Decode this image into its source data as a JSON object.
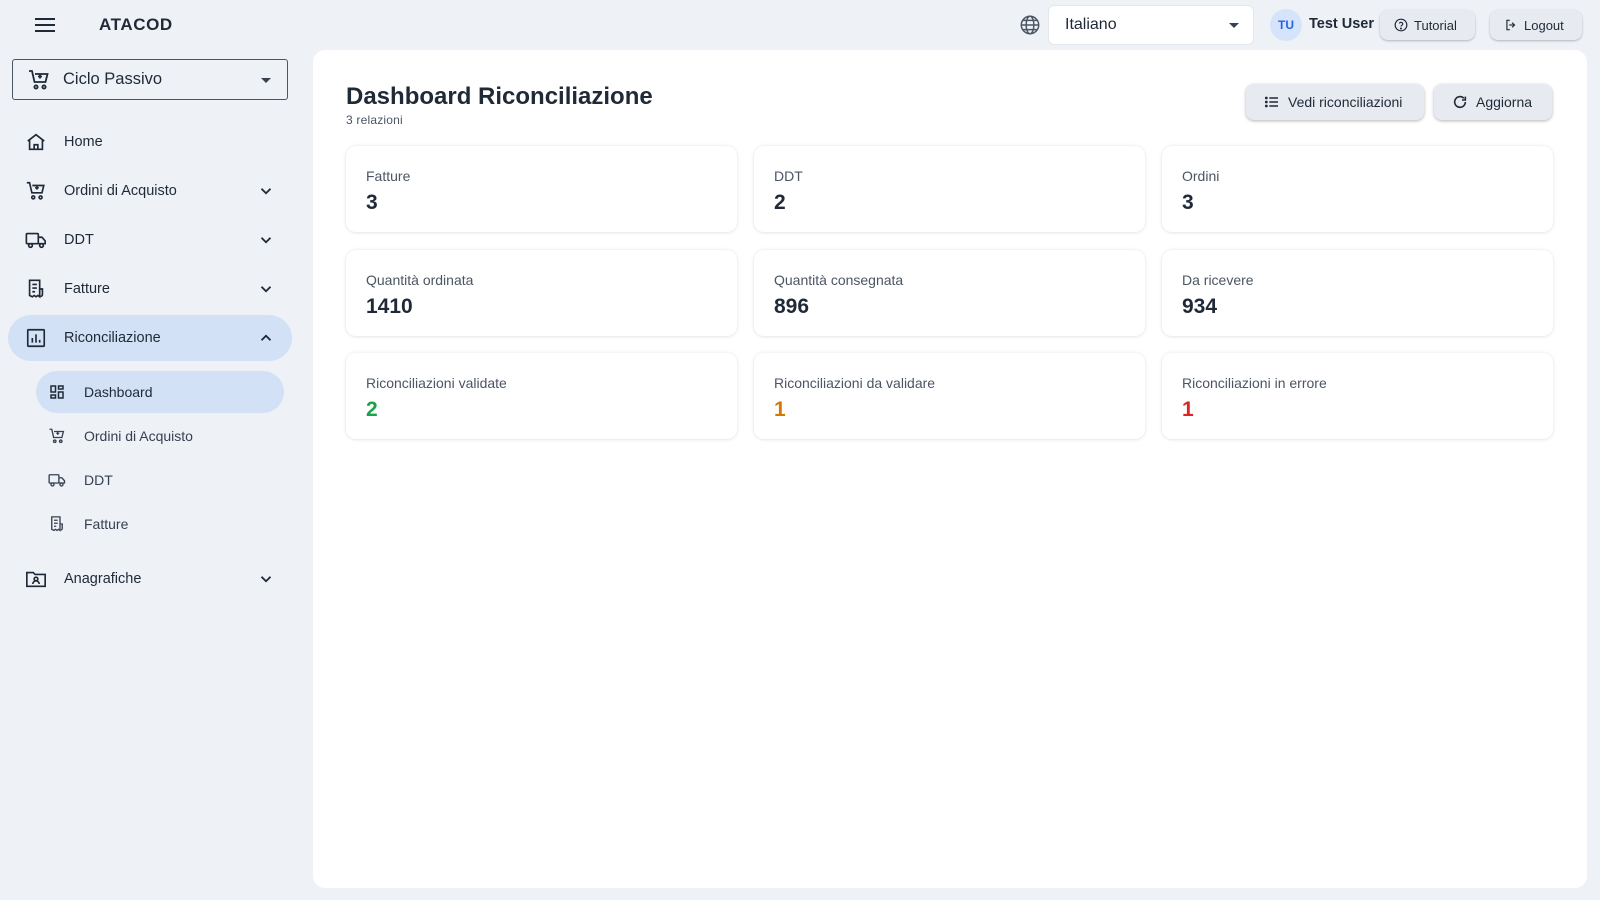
{
  "header": {
    "brand": "ATACOD",
    "language": "Italiano",
    "user_initials": "TU",
    "user_name": "Test User",
    "tutorial_label": "Tutorial",
    "logout_label": "Logout"
  },
  "sidebar": {
    "cycle": "Ciclo Passivo",
    "items": [
      {
        "label": "Home",
        "icon": "home-icon"
      },
      {
        "label": "Ordini di Acquisto",
        "icon": "cart-icon"
      },
      {
        "label": "DDT",
        "icon": "truck-icon"
      },
      {
        "label": "Fatture",
        "icon": "receipt-icon"
      },
      {
        "label": "Riconciliazione",
        "icon": "chart-icon",
        "active": true,
        "expanded": true
      },
      {
        "label": "Anagrafiche",
        "icon": "folder-user-icon"
      }
    ],
    "subitems": [
      {
        "label": "Dashboard",
        "icon": "dashboard-icon",
        "active": true
      },
      {
        "label": "Ordini di Acquisto",
        "icon": "cart-icon"
      },
      {
        "label": "DDT",
        "icon": "truck-icon"
      },
      {
        "label": "Fatture",
        "icon": "receipt-icon"
      }
    ]
  },
  "main": {
    "title": "Dashboard Riconciliazione",
    "subtitle": "3 relazioni",
    "btn_view": "Vedi riconciliazioni",
    "btn_refresh": "Aggiorna",
    "cards": [
      {
        "label": "Fatture",
        "value": "3"
      },
      {
        "label": "DDT",
        "value": "2"
      },
      {
        "label": "Ordini",
        "value": "3"
      },
      {
        "label": "Quantità ordinata",
        "value": "1410"
      },
      {
        "label": "Quantità consegnata",
        "value": "896"
      },
      {
        "label": "Da ricevere",
        "value": "934"
      },
      {
        "label": "Riconciliazioni validate",
        "value": "2",
        "color": "#16a34a"
      },
      {
        "label": "Riconciliazioni da validare",
        "value": "1",
        "color": "#d97706"
      },
      {
        "label": "Riconciliazioni in errore",
        "value": "1",
        "color": "#dc2626"
      }
    ]
  }
}
